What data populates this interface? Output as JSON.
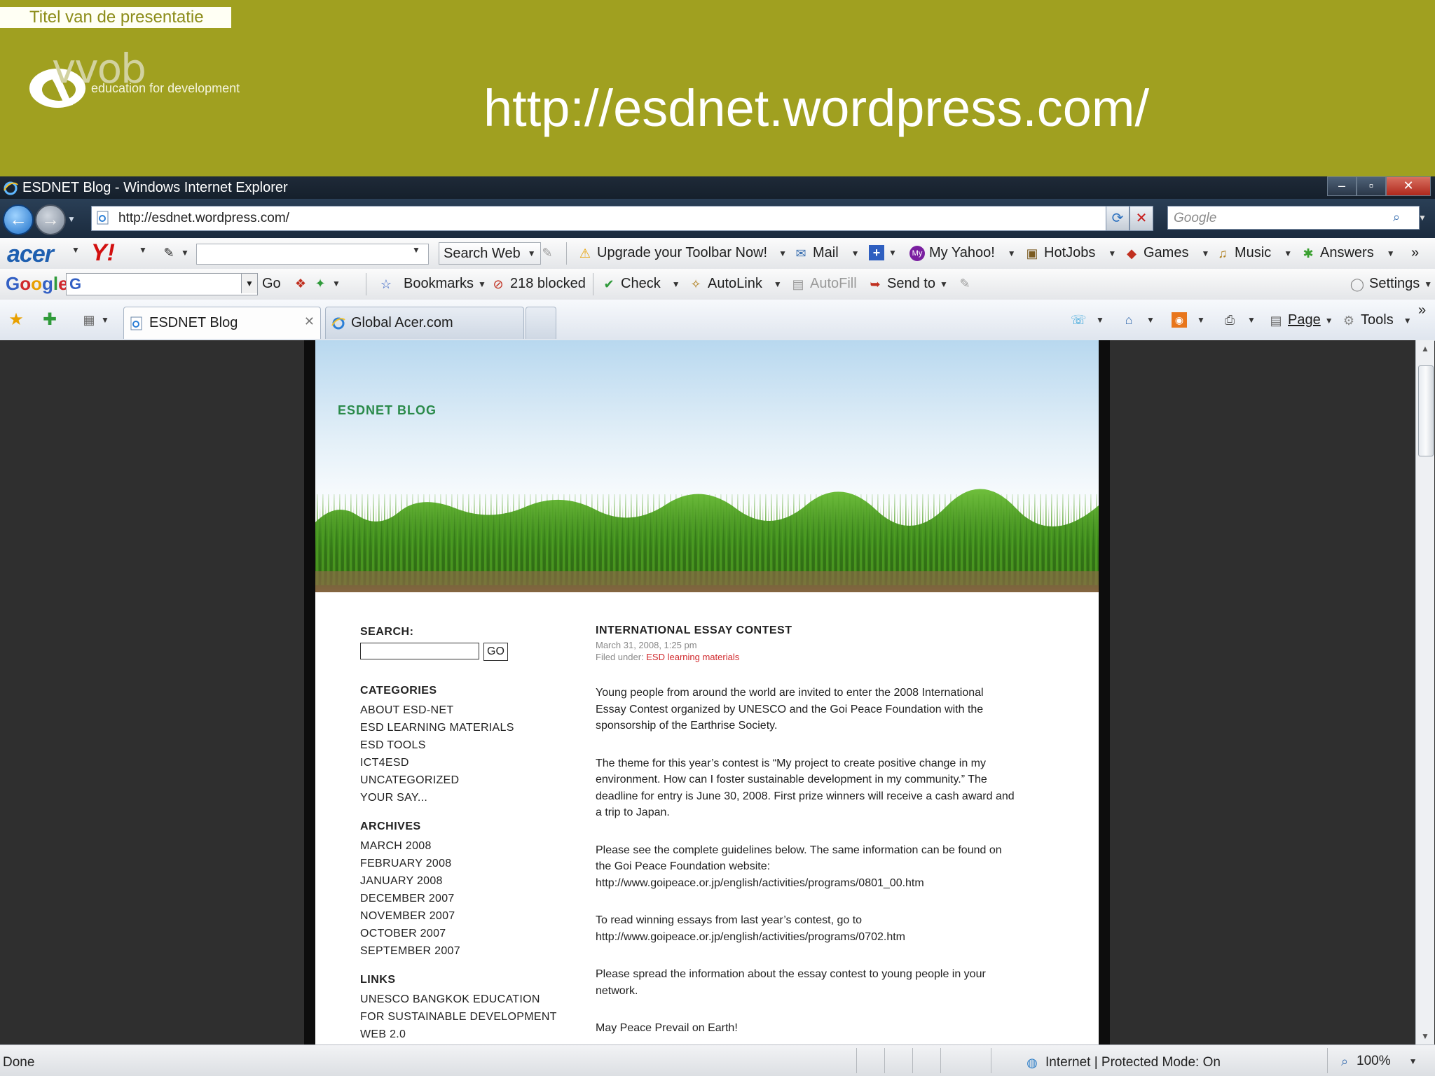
{
  "slide": {
    "title_tag": "Titel van de presentatie",
    "logo_word": "vvob",
    "logo_subtitle": "education for development",
    "url_heading": "http://esdnet.wordpress.com/"
  },
  "window": {
    "title": "ESDNET Blog - Windows Internet Explorer",
    "address": "http://esdnet.wordpress.com/",
    "search_placeholder": "Google"
  },
  "toolbar1": {
    "brand": "acer",
    "yahoo": "Y!",
    "search_web": "Search Web",
    "upgrade": "Upgrade your Toolbar Now!",
    "mail": "Mail",
    "my_yahoo": "My Yahoo!",
    "hotjobs": "HotJobs",
    "games": "Games",
    "music": "Music",
    "answers": "Answers",
    "more": "»"
  },
  "toolbar2": {
    "google": "Google",
    "go": "Go",
    "bookmarks": "Bookmarks",
    "blocked": "218 blocked",
    "check": "Check",
    "autolink": "AutoLink",
    "autofill": "AutoFill",
    "send_to": "Send to",
    "settings": "Settings"
  },
  "tabs": {
    "active": "ESDNET Blog",
    "inactive": "Global Acer.com",
    "page": "Page",
    "tools": "Tools"
  },
  "blog": {
    "title": "ESDNET BLOG",
    "search_label": "SEARCH:",
    "go": "GO",
    "categories_head": "CATEGORIES",
    "categories": [
      "ABOUT ESD-NET",
      "ESD LEARNING MATERIALS",
      "ESD TOOLS",
      "ICT4ESD",
      "UNCATEGORIZED",
      "YOUR SAY..."
    ],
    "archives_head": "ARCHIVES",
    "archives": [
      "MARCH 2008",
      "FEBRUARY 2008",
      "JANUARY 2008",
      "DECEMBER 2007",
      "NOVEMBER 2007",
      "OCTOBER 2007",
      "SEPTEMBER 2007"
    ],
    "links_head": "LINKS",
    "links": [
      "UNESCO BANGKOK EDUCATION",
      "FOR SUSTAINABLE DEVELOPMENT",
      "WEB 2.0"
    ],
    "post": {
      "title": "INTERNATIONAL ESSAY CONTEST",
      "date": "March 31, 2008, 1:25 pm",
      "filed_label": "Filed under: ",
      "filed_category": "ESD learning materials",
      "paragraphs": [
        "Young people from around the world are invited to enter the 2008 International Essay Contest organized by UNESCO and the Goi Peace Foundation with the sponsorship of the Earthrise Society.",
        "The theme for this year’s contest is “My project to create positive change in my environment. How can I foster sustainable development in my community.” The deadline for entry is June 30, 2008. First prize winners will receive a cash award and a trip to Japan.",
        "Please see the complete guidelines below. The same information can be found on the Goi Peace Foundation website: http://www.goipeace.or.jp/english/activities/programs/0801_00.htm",
        "To read winning essays from last year’s contest, go to http://www.goipeace.or.jp/english/activities/programs/0702.htm",
        "Please spread the information about the essay contest to young people in your network.",
        "May Peace Prevail on Earth!"
      ]
    }
  },
  "status": {
    "done": "Done",
    "zone": "Internet | Protected Mode: On",
    "zoom": "100%"
  },
  "colors": {
    "slide_header": "#a0a020",
    "blog_title": "#2a8a4a",
    "post_category": "#d0282c"
  }
}
